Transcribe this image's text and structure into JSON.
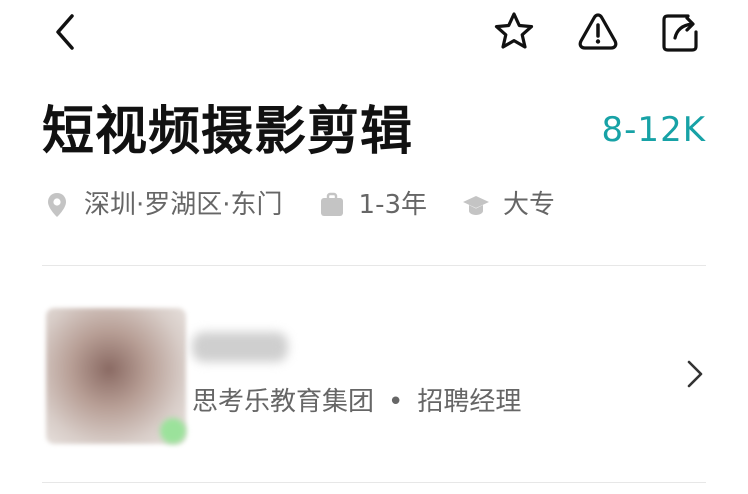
{
  "header": {
    "title": "短视频摄影剪辑",
    "salary": "8-12K"
  },
  "meta": {
    "location": "深圳·罗湖区·东门",
    "experience": "1-3年",
    "education": "大专"
  },
  "recruiter": {
    "company": "思考乐教育集团",
    "separator": "•",
    "role": "招聘经理"
  },
  "colors": {
    "salary": "#17a2a6",
    "meta_text": "#666666",
    "title": "#111111"
  },
  "icons": [
    "back-arrow-icon",
    "star-icon",
    "warning-icon",
    "share-icon",
    "location-icon",
    "briefcase-icon",
    "graduation-cap-icon",
    "chevron-right-icon"
  ]
}
